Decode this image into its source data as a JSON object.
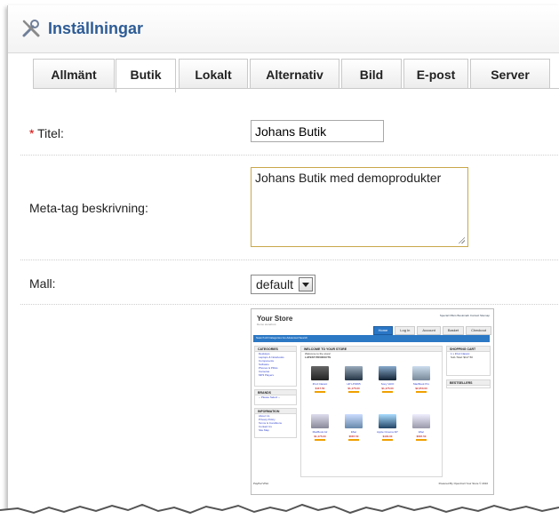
{
  "header": {
    "title": "Inställningar",
    "icon": "tools-icon"
  },
  "tabs": [
    {
      "label": "Allmänt",
      "active": false
    },
    {
      "label": "Butik",
      "active": true
    },
    {
      "label": "Lokalt",
      "active": false
    },
    {
      "label": "Alternativ",
      "active": false
    },
    {
      "label": "Bild",
      "active": false
    },
    {
      "label": "E-post",
      "active": false
    },
    {
      "label": "Server",
      "active": false
    }
  ],
  "form": {
    "title": {
      "required_mark": "*",
      "label": "Titel:",
      "value": "Johans Butik"
    },
    "meta": {
      "label": "Meta-tag beskrivning:",
      "value": "Johans Butik med demoprodukter"
    },
    "template": {
      "label": "Mall:",
      "selected": "default"
    }
  },
  "preview": {
    "logo": "Your Store",
    "logo_sub": "Demo storefront",
    "top_links": "Special Offers  Bookmark  Contact  Sitemap",
    "nav": [
      "Home",
      "Log In",
      "Account",
      "Basket",
      "Checkout"
    ],
    "search_bar": "Search    All Categories    Go    Advanced Search",
    "categories_title": "CATEGORIES",
    "categories": [
      "Desktops",
      "Laptops & Notebooks",
      "Components",
      "Software",
      "Phones & PDAs",
      "Cameras",
      "MP3 Players"
    ],
    "brands_title": "BRANDS",
    "brands_select": "-- Please Select --",
    "information_title": "INFORMATION",
    "information": [
      "About Us",
      "Privacy Policy",
      "Terms & Conditions",
      "Contact Us",
      "Site Map"
    ],
    "welcome": "WELCOME TO YOUR STORE",
    "welcome_sub": "Welcome to the store!",
    "latest": "LATEST PRODUCTS",
    "products": [
      {
        "name": "iPod Classic",
        "price": "$117.50"
      },
      {
        "name": "HP LP3065",
        "price": "$1,175.00"
      },
      {
        "name": "Sony VAIO",
        "price": "$1,175.00"
      },
      {
        "name": "MacBook Pro",
        "price": "$2,350.00"
      },
      {
        "name": "MacBook Air",
        "price": "$1,175.00"
      },
      {
        "name": "iMac",
        "price": "$587.50"
      },
      {
        "name": "Apple Cinema 30\"",
        "price": "$100.00"
      },
      {
        "name": "iMac",
        "price": "$587.50"
      }
    ],
    "cart_title": "SHOPPING CART",
    "cart_line": "1 x  iPod Classic",
    "cart_total": "Sub-Total: $117.50",
    "bestsellers_title": "BESTSELLERS",
    "footer_left": "PayPal  VISA",
    "footer_right": "Powered By OpenCart  Your Store © 2010"
  }
}
